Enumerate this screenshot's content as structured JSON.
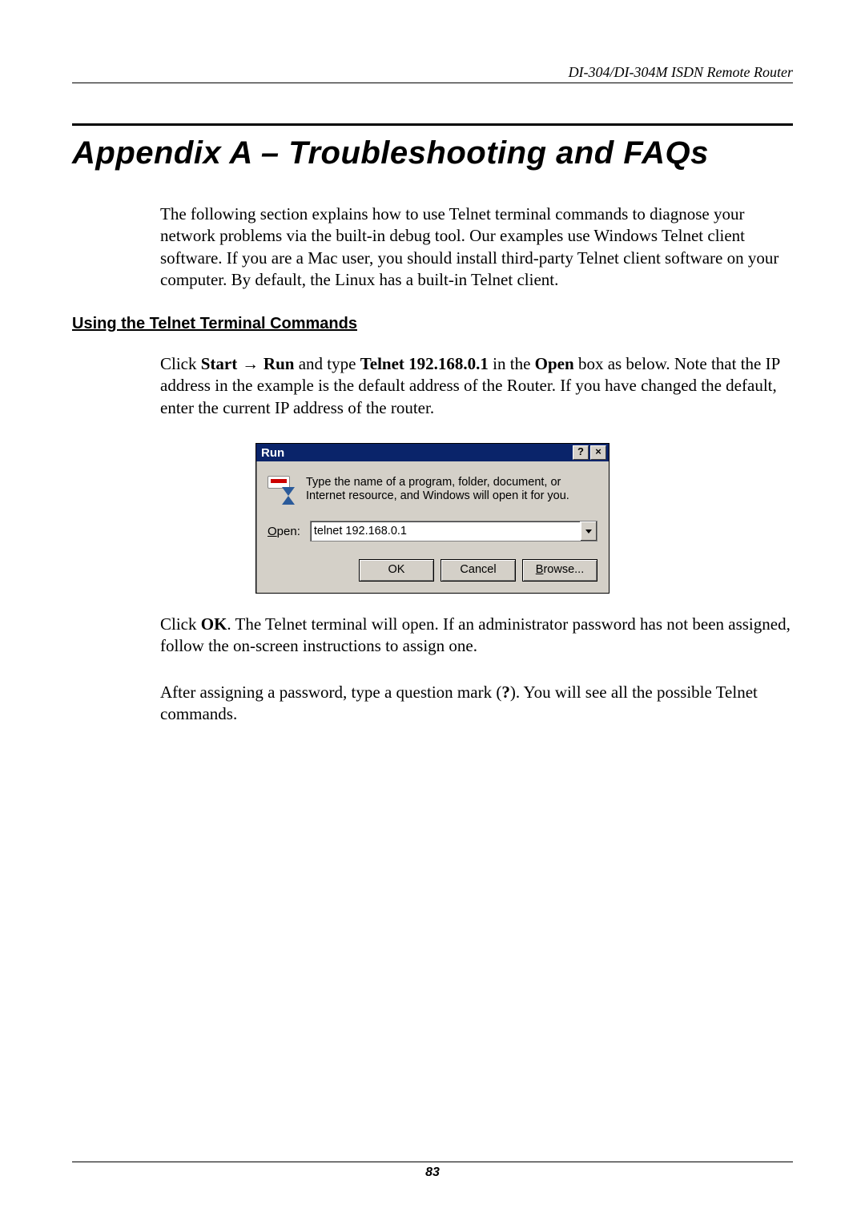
{
  "header": {
    "running_title": "DI-304/DI-304M ISDN Remote Router"
  },
  "title": "Appendix A – Troubleshooting and FAQs",
  "intro": "The following section explains how to use Telnet terminal commands to diagnose your network problems via the built-in debug tool. Our examples use Windows Telnet client software. If you are a Mac user, you should install third-party Telnet client software on your computer. By default, the Linux has a built-in Telnet client.",
  "section_heading": "Using the Telnet Terminal Commands",
  "para1": {
    "p1": "Click ",
    "b1": "Start",
    "arrow": " → ",
    "b2": "Run",
    "p2": " and type ",
    "b3": "Telnet 192.168.0.1",
    "p3": " in the ",
    "b4": "Open",
    "p4": " box as below. Note that the IP address in the example is the default address of the Router. If you have changed the default, enter the current IP address of the router."
  },
  "run_dialog": {
    "title": "Run",
    "help_btn": "?",
    "close_btn": "×",
    "description": "Type the name of a program, folder, document, or Internet resource, and Windows will open it for you.",
    "open_label_u": "O",
    "open_label_rest": "pen:",
    "input_value": "telnet 192.168.0.1",
    "ok": "OK",
    "cancel": "Cancel",
    "browse_u": "B",
    "browse_rest": "rowse..."
  },
  "para2": {
    "p1": "Click ",
    "b1": "OK",
    "p2": ". The Telnet terminal will open. If an administrator password has not been assigned, follow the on-screen instructions to assign one."
  },
  "para3": {
    "p1": "After assigning a password, type a question mark (",
    "b1": "?",
    "p2": "). You will see all the possible Telnet commands."
  },
  "page_number": "83"
}
